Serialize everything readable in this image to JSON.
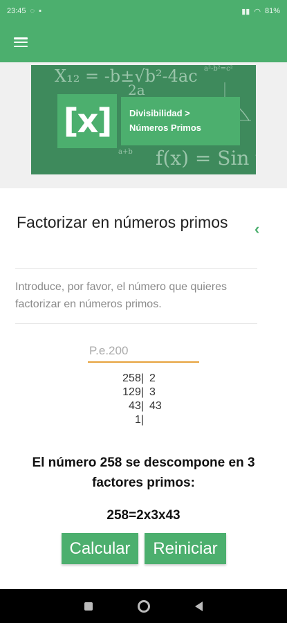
{
  "status_bar": {
    "time": "23:45",
    "battery": "81%"
  },
  "hero": {
    "logo_text": "[x]",
    "breadcrumb_line1": "Divisibilidad >",
    "breadcrumb_line2": "Números Primos"
  },
  "card": {
    "title": "Factorizar en números primos",
    "instructions": "Introduce, por favor, el número que quieres factorizar en números primos."
  },
  "input": {
    "placeholder": "P.e.200",
    "value": ""
  },
  "factorization": [
    {
      "dividend": "258|",
      "divisor": "2"
    },
    {
      "dividend": "129|",
      "divisor": "3"
    },
    {
      "dividend": "43|",
      "divisor": "43"
    },
    {
      "dividend": "1|",
      "divisor": ""
    }
  ],
  "result": {
    "message": "El número 258 se descompone en 3 factores primos:",
    "expression": "258=2x3x43"
  },
  "buttons": {
    "calculate": "Calcular",
    "reset": "Reiniciar"
  },
  "colors": {
    "primary": "#4caf6e",
    "accent": "#e6a23c"
  }
}
